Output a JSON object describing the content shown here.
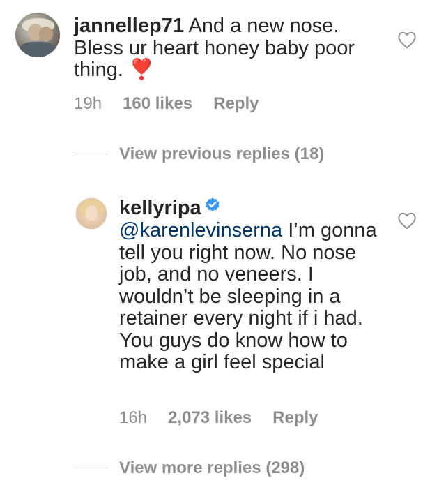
{
  "comment1": {
    "username": "jannellep71",
    "text": "And a new nose. Bless ur heart honey baby poor thing.",
    "emoji": "❣️",
    "time": "19h",
    "likes": "160 likes",
    "reply_label": "Reply"
  },
  "view_previous": {
    "label": "View previous replies (18)"
  },
  "comment2": {
    "username": "kellyripa",
    "mention": "@karenlevinserna",
    "text": "I’m gonna tell you right now. No nose job, and no veneers. I wouldn’t be sleeping in a retainer every night if i had. You guys do know how to make a girl feel special",
    "time": "16h",
    "likes": "2,073 likes",
    "reply_label": "Reply"
  },
  "view_more": {
    "label": "View more replies (298)"
  },
  "colors": {
    "text": "#262626",
    "secondary": "#8e8e8e",
    "mention": "#00376b",
    "verified": "#3897f0",
    "heart_emoji": "#e0245e"
  }
}
